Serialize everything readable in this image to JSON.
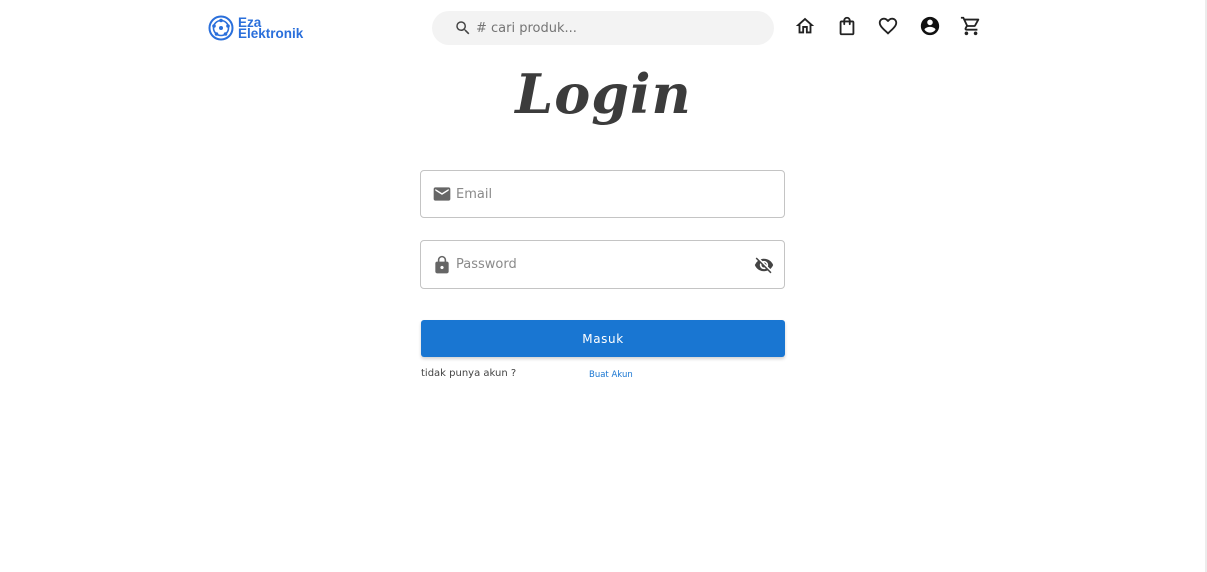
{
  "brand": {
    "line1": "Eza",
    "line2": "Elektronik",
    "color": "#2a6fdb"
  },
  "search": {
    "placeholder": "# cari produk...",
    "icon": "search-icon"
  },
  "nav": {
    "icons": [
      "home-icon",
      "shopping-bag-icon",
      "heart-icon",
      "account-circle-icon",
      "cart-icon"
    ]
  },
  "login": {
    "title": "Login",
    "email_placeholder": "Email",
    "password_placeholder": "Password",
    "submit_label": "Masuk",
    "no_account_text": "tidak punya akun ?",
    "register_link": "Buat Akun"
  },
  "colors": {
    "primary": "#1976d2",
    "text_dark": "#3c3c3c",
    "border": "#c4c4c4"
  }
}
